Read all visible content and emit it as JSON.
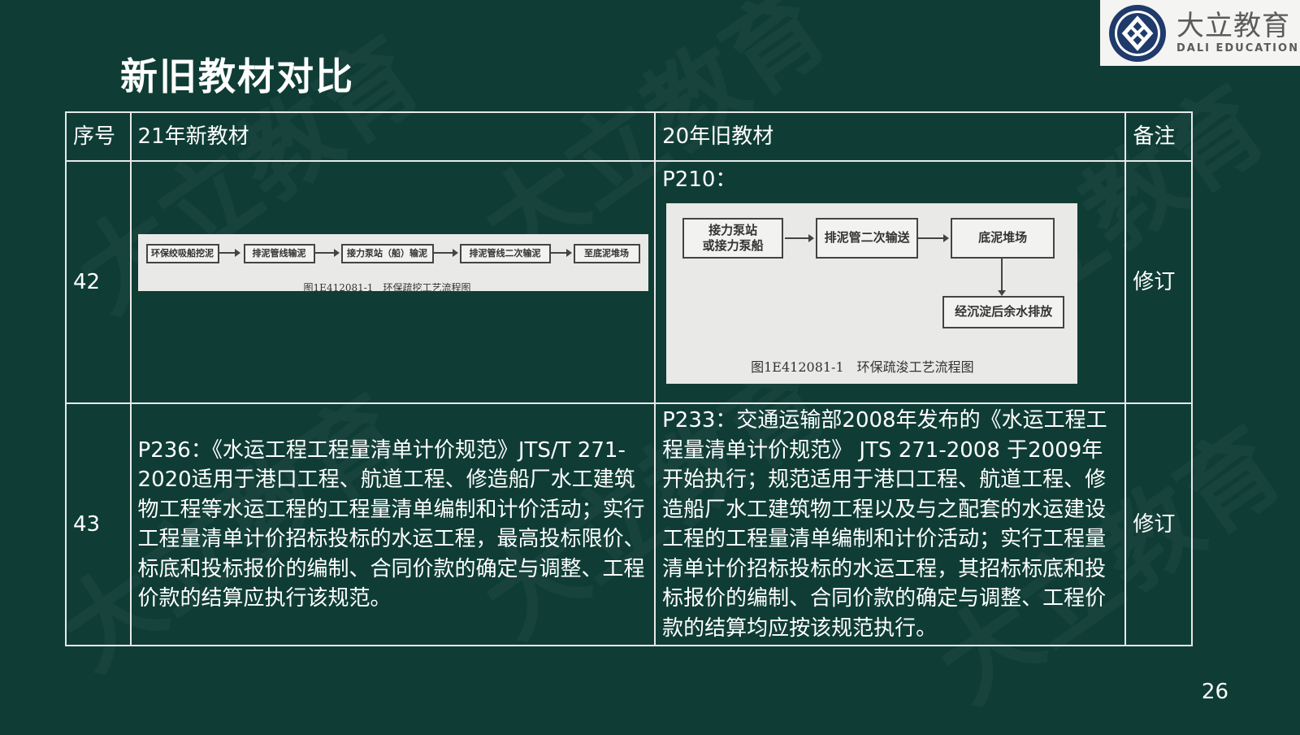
{
  "slide": {
    "title": "新旧教材对比",
    "page_number": "26"
  },
  "logo": {
    "cn": "大立教育",
    "en": "DALI EDUCATION",
    "icon": "dali-logo-icon"
  },
  "watermark": "大立教育",
  "table": {
    "headers": [
      "序号",
      "21年新教材",
      "20年旧教材",
      "备注"
    ],
    "rows": [
      {
        "no": "42",
        "new_flow": {
          "steps": [
            "环保绞吸船挖泥",
            "排泥管线输泥",
            "接力泵站（船）输泥",
            "排泥管线二次输泥",
            "至底泥堆场"
          ],
          "caption": "图1E412081-1　环保疏挖工艺流程图"
        },
        "old_page": "P210：",
        "old_flow": {
          "steps": [
            "接力泵站\n或接力泵船",
            "排泥管二次输送",
            "底泥堆场",
            "经沉淀后余水排放"
          ],
          "caption": "图1E412081-1　环保疏浚工艺流程图"
        },
        "note": "修订"
      },
      {
        "no": "43",
        "new_text": "P236：《水运工程工程量清单计价规范》JTS/T 271-2020适用于港口工程、航道工程、修造船厂水工建筑物工程等水运工程的工程量清单编制和计价活动；实行工程量清单计价招标投标的水运工程，最高投标限价、标底和投标报价的编制、合同价款的确定与调整、工程价款的结算应执行该规范。",
        "old_text": "P233：交通运输部2008年发布的《水运工程工程量清单计价规范》 JTS 271-2008 于2009年开始执行；规范适用于港口工程、航道工程、修造船厂水工建筑物工程以及与之配套的水运建设工程的工程量清单编制和计价活动；实行工程量清单计价招标投标的水运工程，其招标标底和投标报价的编制、合同价款的确定与调整、工程价款的结算均应按该规范执行。",
        "note": "修订"
      }
    ]
  }
}
